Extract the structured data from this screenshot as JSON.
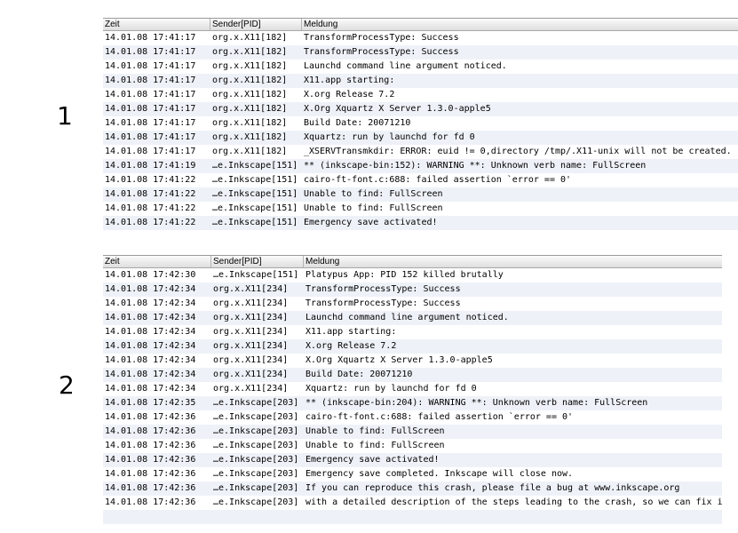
{
  "sections": [
    {
      "number": "1"
    },
    {
      "number": "2"
    }
  ],
  "columns": {
    "time": "Zeit",
    "sender": "Sender[PID]",
    "message": "Meldung"
  },
  "log1": [
    [
      "14.01.08 17:41:17",
      "org.x.X11[182]",
      "TransformProcessType: Success"
    ],
    [
      "14.01.08 17:41:17",
      "org.x.X11[182]",
      "TransformProcessType: Success"
    ],
    [
      "14.01.08 17:41:17",
      "org.x.X11[182]",
      "Launchd command line argument noticed."
    ],
    [
      "14.01.08 17:41:17",
      "org.x.X11[182]",
      "X11.app starting:"
    ],
    [
      "14.01.08 17:41:17",
      "org.x.X11[182]",
      "X.org Release 7.2"
    ],
    [
      "14.01.08 17:41:17",
      "org.x.X11[182]",
      "X.Org Xquartz X Server 1.3.0-apple5"
    ],
    [
      "14.01.08 17:41:17",
      "org.x.X11[182]",
      "Build Date: 20071210"
    ],
    [
      "14.01.08 17:41:17",
      "org.x.X11[182]",
      "Xquartz: run by launchd for fd 0"
    ],
    [
      "14.01.08 17:41:17",
      "org.x.X11[182]",
      "_XSERVTransmkdir: ERROR: euid != 0,directory /tmp/.X11-unix will not be created."
    ],
    [
      "14.01.08 17:41:19",
      "…e.Inkscape[151]",
      "** (inkscape-bin:152): WARNING **: Unknown verb name: FullScreen"
    ],
    [
      "14.01.08 17:41:22",
      "…e.Inkscape[151]",
      "cairo-ft-font.c:688: failed assertion `error == 0'"
    ],
    [
      "14.01.08 17:41:22",
      "…e.Inkscape[151]",
      "Unable to find: FullScreen"
    ],
    [
      "14.01.08 17:41:22",
      "…e.Inkscape[151]",
      "Unable to find: FullScreen"
    ],
    [
      "14.01.08 17:41:22",
      "…e.Inkscape[151]",
      "Emergency save activated!"
    ]
  ],
  "log2": [
    [
      "14.01.08 17:42:30",
      "…e.Inkscape[151]",
      "Platypus App: PID 152 killed brutally"
    ],
    [
      "14.01.08 17:42:34",
      "org.x.X11[234]",
      "TransformProcessType: Success"
    ],
    [
      "14.01.08 17:42:34",
      "org.x.X11[234]",
      "TransformProcessType: Success"
    ],
    [
      "14.01.08 17:42:34",
      "org.x.X11[234]",
      "Launchd command line argument noticed."
    ],
    [
      "14.01.08 17:42:34",
      "org.x.X11[234]",
      "X11.app starting:"
    ],
    [
      "14.01.08 17:42:34",
      "org.x.X11[234]",
      "X.org Release 7.2"
    ],
    [
      "14.01.08 17:42:34",
      "org.x.X11[234]",
      "X.Org Xquartz X Server 1.3.0-apple5"
    ],
    [
      "14.01.08 17:42:34",
      "org.x.X11[234]",
      "Build Date: 20071210"
    ],
    [
      "14.01.08 17:42:34",
      "org.x.X11[234]",
      "Xquartz: run by launchd for fd 0"
    ],
    [
      "14.01.08 17:42:35",
      "…e.Inkscape[203]",
      "** (inkscape-bin:204): WARNING **: Unknown verb name: FullScreen"
    ],
    [
      "14.01.08 17:42:36",
      "…e.Inkscape[203]",
      "cairo-ft-font.c:688: failed assertion `error == 0'"
    ],
    [
      "14.01.08 17:42:36",
      "…e.Inkscape[203]",
      "Unable to find: FullScreen"
    ],
    [
      "14.01.08 17:42:36",
      "…e.Inkscape[203]",
      "Unable to find: FullScreen"
    ],
    [
      "14.01.08 17:42:36",
      "…e.Inkscape[203]",
      "Emergency save activated!"
    ],
    [
      "14.01.08 17:42:36",
      "…e.Inkscape[203]",
      "Emergency save completed. Inkscape will close now."
    ],
    [
      "14.01.08 17:42:36",
      "…e.Inkscape[203]",
      "If you can reproduce this crash, please file a bug at www.inkscape.org"
    ],
    [
      "14.01.08 17:42:36",
      "…e.Inkscape[203]",
      "with a detailed description of the steps leading to the crash, so we can fix it."
    ]
  ]
}
